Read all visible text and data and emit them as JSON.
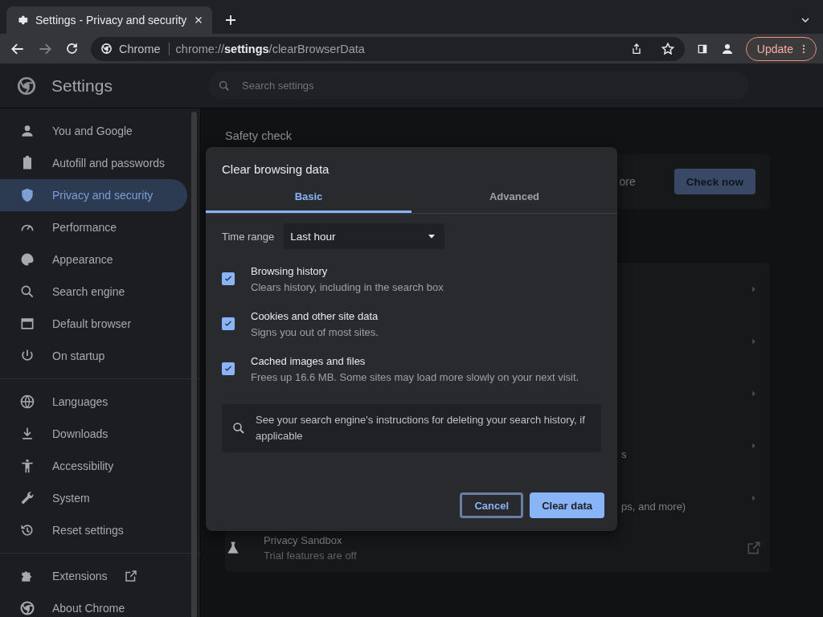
{
  "browser_tab": {
    "title": "Settings - Privacy and security"
  },
  "toolbar": {
    "site_chip": "Chrome",
    "url": "chrome://**settings**/clearBrowserData",
    "update_button": "Update"
  },
  "settings_header": {
    "title": "Settings",
    "search": {
      "placeholder": "Search settings"
    }
  },
  "sidebar": {
    "groups": [
      {
        "items": [
          {
            "label": "You and Google",
            "selected": false,
            "kind": "page"
          },
          {
            "label": "Autofill and passwords",
            "selected": false,
            "kind": "page"
          },
          {
            "label": "Privacy and security",
            "selected": true,
            "kind": "page"
          },
          {
            "label": "Performance",
            "selected": false,
            "kind": "page"
          },
          {
            "label": "Appearance",
            "selected": false,
            "kind": "page"
          },
          {
            "label": "Search engine",
            "selected": false,
            "kind": "page"
          },
          {
            "label": "Default browser",
            "selected": false,
            "kind": "page"
          },
          {
            "label": "On startup",
            "selected": false,
            "kind": "page"
          }
        ]
      },
      {
        "items": [
          {
            "label": "Languages",
            "selected": false,
            "kind": "page"
          },
          {
            "label": "Downloads",
            "selected": false,
            "kind": "page"
          },
          {
            "label": "Accessibility",
            "selected": false,
            "kind": "page"
          },
          {
            "label": "System",
            "selected": false,
            "kind": "page"
          },
          {
            "label": "Reset settings",
            "selected": false,
            "kind": "page"
          }
        ]
      },
      {
        "items": [
          {
            "label": "Extensions",
            "selected": false,
            "kind": "external"
          },
          {
            "label": "About Chrome",
            "selected": false,
            "kind": "page"
          }
        ]
      }
    ]
  },
  "page": {
    "section_title": "Safety check",
    "safety_card": {
      "text": "ore",
      "button": "Check now"
    },
    "rows": [
      {
        "kind": "link"
      },
      {
        "kind": "link"
      },
      {
        "kind": "link"
      },
      {
        "kind": "link",
        "subtitle": "s"
      },
      {
        "kind": "link",
        "subtitle": "ps, and more)"
      },
      {
        "kind": "external",
        "title": "Privacy Sandbox",
        "subtitle": "Trial features are off"
      }
    ]
  },
  "dialog": {
    "title": "Clear browsing data",
    "tabs": [
      {
        "label": "Basic",
        "selected": true
      },
      {
        "label": "Advanced",
        "selected": false
      }
    ],
    "time_range": {
      "label": "Time range",
      "value": "Last hour"
    },
    "options": [
      {
        "label": "Browsing history",
        "description": "Clears history, including in the search box",
        "checked": true
      },
      {
        "label": "Cookies and other site data",
        "description": "Signs you out of most sites.",
        "checked": true
      },
      {
        "label": "Cached images and files",
        "description": "Frees up 16.6 MB. Some sites may load more slowly on your next visit.",
        "checked": true
      }
    ],
    "note": "See your search engine's instructions for deleting your search history, if applicable",
    "buttons": [
      {
        "label": "Cancel",
        "kind": "secondary",
        "focused": true
      },
      {
        "label": "Clear data",
        "kind": "primary",
        "focused": false
      }
    ]
  }
}
